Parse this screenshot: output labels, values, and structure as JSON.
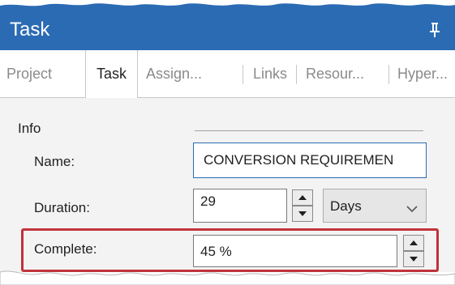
{
  "window": {
    "title": "Task"
  },
  "tabs": [
    {
      "label": "Project",
      "active": false
    },
    {
      "label": "Task",
      "active": true
    },
    {
      "label": "Assign...",
      "active": false
    },
    {
      "label": "Links",
      "active": false
    },
    {
      "label": "Resour...",
      "active": false
    },
    {
      "label": "Hyper...",
      "active": false
    }
  ],
  "info": {
    "section_label": "Info",
    "name_label": "Name:",
    "name_value": "CONVERSION REQUIREMEN",
    "duration_label": "Duration:",
    "duration_value": "29",
    "duration_unit": "Days",
    "complete_label": "Complete:",
    "complete_value": "45 %"
  },
  "icons": {
    "pin": "pin-icon",
    "spin_up": "spin-up-arrow-icon",
    "spin_down": "spin-down-arrow-icon",
    "dropdown": "chevron-down-icon"
  },
  "colors": {
    "titlebar": "#2b6bb3",
    "panel": "#f3f3f3",
    "highlight": "#c0333a"
  }
}
